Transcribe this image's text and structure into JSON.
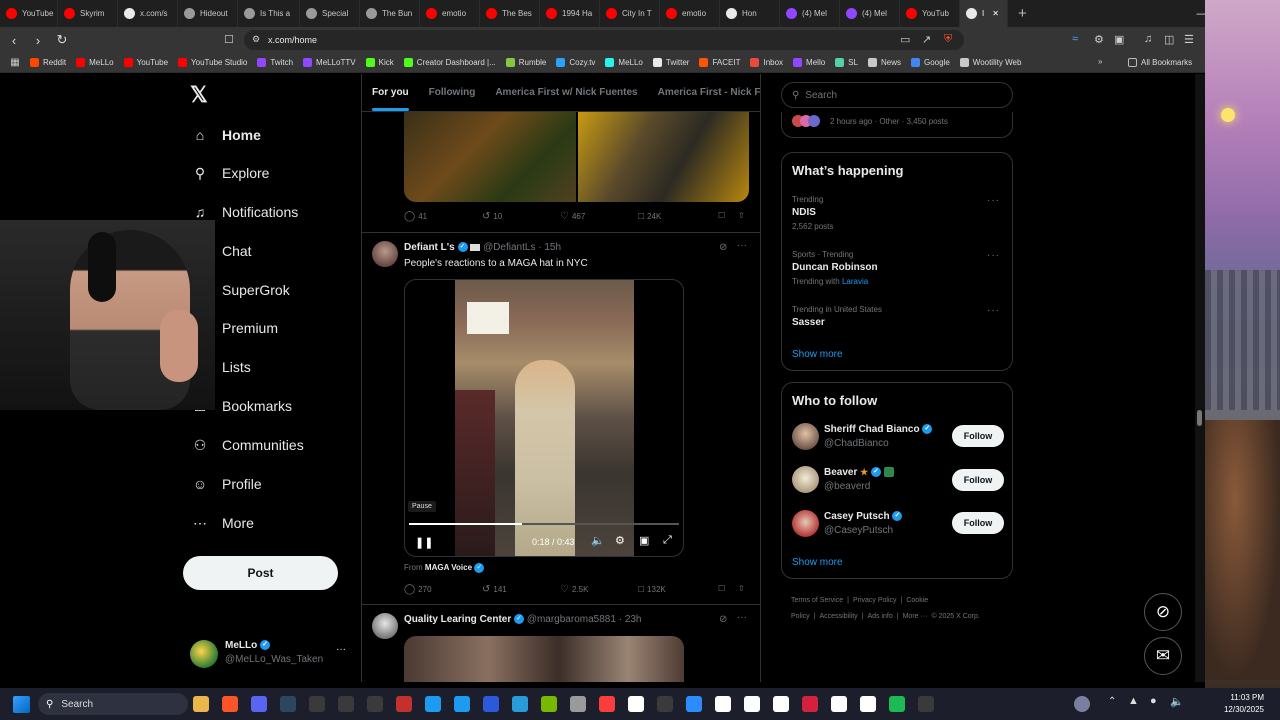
{
  "browser": {
    "tabs": [
      {
        "label": "YouTube",
        "color": "#ff0000"
      },
      {
        "label": "Skyrim",
        "color": "#ff0000"
      },
      {
        "label": "x.com/s",
        "color": "#e7e9ea"
      },
      {
        "label": "Hideout",
        "color": "#9a9a9a"
      },
      {
        "label": "Is This a",
        "color": "#9a9a9a"
      },
      {
        "label": "Special",
        "color": "#9a9a9a"
      },
      {
        "label": "The Bun",
        "color": "#9a9a9a"
      },
      {
        "label": "emotio",
        "color": "#ff0000"
      },
      {
        "label": "The Bes",
        "color": "#ff0000"
      },
      {
        "label": "1994 Ha",
        "color": "#ff0000"
      },
      {
        "label": "City In T",
        "color": "#ff0000"
      },
      {
        "label": "emotio",
        "color": "#ff0000"
      },
      {
        "label": "Hon",
        "color": "#e7e9ea"
      },
      {
        "label": "(4) Mel",
        "color": "#9146ff"
      },
      {
        "label": "(4) Mel",
        "color": "#9146ff"
      },
      {
        "label": "YouTub",
        "color": "#ff0000"
      },
      {
        "label": "I",
        "color": "#e7e9ea"
      }
    ],
    "url": "x.com/home",
    "bookmarks": [
      {
        "label": "Reddit",
        "color": "#ff4500"
      },
      {
        "label": "MeLLo",
        "color": "#ff0000"
      },
      {
        "label": "YouTube",
        "color": "#ff0000"
      },
      {
        "label": "YouTube Studio",
        "color": "#ff0000"
      },
      {
        "label": "Twitch",
        "color": "#9146ff"
      },
      {
        "label": "MeLLoTTV",
        "color": "#9146ff"
      },
      {
        "label": "Kick",
        "color": "#53fc18"
      },
      {
        "label": "Creator Dashboard |...",
        "color": "#53fc18"
      },
      {
        "label": "Rumble",
        "color": "#85c742"
      },
      {
        "label": "Cozy.tv",
        "color": "#2aa3ff"
      },
      {
        "label": "MeLLo",
        "color": "#25f4ee"
      },
      {
        "label": "Twitter",
        "color": "#e7e9ea"
      },
      {
        "label": "FACEIT",
        "color": "#ff5500"
      },
      {
        "label": "Inbox",
        "color": "#e84a3c"
      },
      {
        "label": "Mello",
        "color": "#9146ff"
      },
      {
        "label": "SL",
        "color": "#53d3a3"
      },
      {
        "label": "News",
        "color": "#c9c9c9"
      },
      {
        "label": "Google",
        "color": "#4285f4"
      },
      {
        "label": "Wootility Web",
        "color": "#c9c9c9"
      }
    ],
    "all_bookmarks": "All Bookmarks"
  },
  "nav": {
    "items": [
      {
        "label": "Home",
        "icon": "home-icon"
      },
      {
        "label": "Explore",
        "icon": "search-icon"
      },
      {
        "label": "Notifications",
        "icon": "bell-icon"
      },
      {
        "label": "Chat",
        "icon": "chat-icon"
      },
      {
        "label": "SuperGrok",
        "icon": "grok-icon"
      },
      {
        "label": "Premium",
        "icon": "x-premium-icon"
      },
      {
        "label": "Lists",
        "icon": "list-icon"
      },
      {
        "label": "Bookmarks",
        "icon": "bookmark-icon"
      },
      {
        "label": "Communities",
        "icon": "communities-icon"
      },
      {
        "label": "Profile",
        "icon": "person-icon"
      },
      {
        "label": "More",
        "icon": "more-circle-icon"
      }
    ],
    "post_label": "Post",
    "user": {
      "name": "MeLLo",
      "handle": "@MeLLo_Was_Taken"
    }
  },
  "feed": {
    "tabs": [
      "For you",
      "Following",
      "America First w/ Nick Fuentes",
      "America First - Nick Fu"
    ],
    "post1_stats": {
      "replies": "41",
      "reposts": "10",
      "likes": "467",
      "views": "24K"
    },
    "post2": {
      "author": "Defiant L's",
      "handle": "@DefiantLs",
      "time": "15h",
      "text": "People's reactions to a MAGA hat in NYC",
      "video": {
        "tooltip": "Pause",
        "time": "0:18 / 0:43",
        "progress": 0.42
      },
      "from_label": "From",
      "from_source": "MAGA Voice",
      "stats": {
        "replies": "270",
        "reposts": "141",
        "likes": "2.5K",
        "views": "132K"
      }
    },
    "post3": {
      "author": "Quality Learing Center",
      "handle": "@margbaroma5881",
      "time": "23h"
    }
  },
  "sidebar": {
    "search_placeholder": "Search",
    "space_meta": "2 hours ago · Other · 3,450 posts",
    "whats_happening": "What’s happening",
    "trends": [
      {
        "meta": "Trending",
        "title": "NDIS",
        "sub": "2,562 posts"
      },
      {
        "meta": "Sports · Trending",
        "title": "Duncan Robinson",
        "sub_prefix": "Trending with",
        "sub_link": "Laravia"
      },
      {
        "meta": "Trending in United States",
        "title": "Sasser"
      }
    ],
    "show_more": "Show more",
    "who_to_follow": "Who to follow",
    "follow_suggestions": [
      {
        "name": "Sheriff Chad Bianco",
        "handle": "@ChadBianco",
        "button": "Follow"
      },
      {
        "name": "Beaver",
        "handle": "@beaverd",
        "button": "Follow"
      },
      {
        "name": "Casey Putsch",
        "handle": "@CaseyPutsch",
        "button": "Follow"
      }
    ],
    "show_more_2": "Show more",
    "footer": [
      "Terms of Service",
      "|",
      "Privacy Policy",
      "|",
      "Cookie Policy",
      "|",
      "Accessibility",
      "|",
      "Ads info",
      "|",
      "More ···",
      "© 2025 X Corp."
    ]
  },
  "taskbar": {
    "search": "Search",
    "time": "11:03 PM",
    "date": "12/30/2025"
  }
}
